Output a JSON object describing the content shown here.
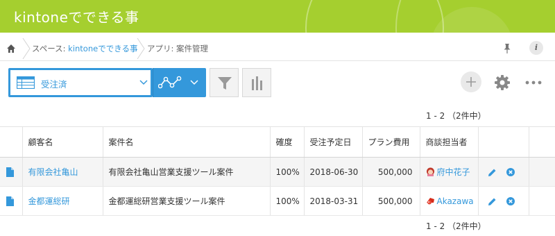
{
  "header": {
    "title": "kintoneでできる事"
  },
  "breadcrumb": {
    "space_prefix": "スペース: ",
    "space_name": "kintoneでできる事",
    "app": "アプリ: 案件管理"
  },
  "toolbar": {
    "view_name": "受注済",
    "accent": "#3498db"
  },
  "pager": {
    "top": "1 - 2 （2件中）",
    "bottom": "1 - 2 （2件中）"
  },
  "table": {
    "columns": [
      "顧客名",
      "案件名",
      "確度",
      "受注予定日",
      "プラン費用",
      "商談担当者"
    ],
    "rows": [
      {
        "customer": "有限会社亀山",
        "project": "有限会社亀山営業支援ツール案件",
        "probability": "100%",
        "date": "2018-06-30",
        "cost": "500,000",
        "rep": "府中花子"
      },
      {
        "customer": "金都運総研",
        "project": "金都運総研営業支援ツール案件",
        "probability": "100%",
        "date": "2018-03-31",
        "cost": "500,000",
        "rep": "Akazawa"
      }
    ]
  },
  "colors": {
    "header_green": "#a5cf2f",
    "link_blue": "#3498db"
  }
}
